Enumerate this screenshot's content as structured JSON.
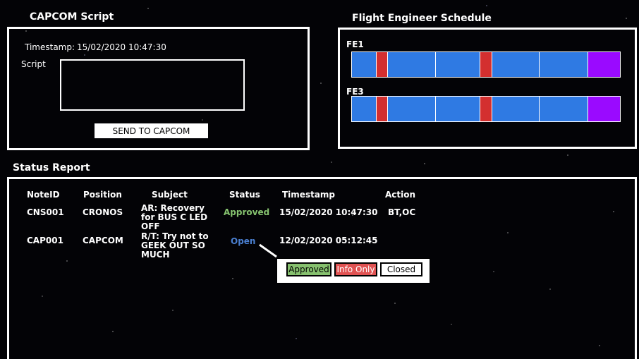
{
  "capcom": {
    "title": "CAPCOM Script",
    "timestamp_label": "Timestamp:",
    "timestamp_value": "15/02/2020 10:47:30",
    "script_label": "Script",
    "script_value": "",
    "send_button": "SEND TO CAPCOM"
  },
  "schedule": {
    "title": "Flight Engineer Schedule",
    "rows": [
      {
        "label": "FE1",
        "segments": [
          "blue",
          "red",
          "blue",
          "blue",
          "red",
          "blue",
          "blue",
          "purple"
        ]
      },
      {
        "label": "FE3",
        "segments": [
          "blue",
          "red",
          "blue",
          "blue",
          "red",
          "blue",
          "blue",
          "purple"
        ]
      }
    ]
  },
  "status": {
    "title": "Status Report",
    "columns": [
      "NoteID",
      "Position",
      "Subject",
      "Status",
      "Timestamp",
      "Action"
    ],
    "rows": [
      {
        "note_id": "CNS001",
        "position": "CRONOS",
        "subject": "AR: Recovery for BUS C LED OFF",
        "status": "Approved",
        "timestamp": "15/02/2020 10:47:30",
        "action": "BT,OC"
      },
      {
        "note_id": "CAP001",
        "position": "CAPCOM",
        "subject": "R/T: Try not to GEEK OUT SO MUCH",
        "status": "Open",
        "timestamp": "12/02/2020 05:12:45",
        "action": ""
      }
    ]
  },
  "status_popup": {
    "options": [
      "Approved",
      "Info Only",
      "Closed"
    ]
  },
  "colors": {
    "blue_segment": "#2f7ae3",
    "red_segment": "#d32f2f",
    "purple_segment": "#9a0aff",
    "approved_text": "#86c36f",
    "open_text": "#4a7fd0",
    "approved_button": "#86c06e",
    "info_button": "#e05252"
  }
}
